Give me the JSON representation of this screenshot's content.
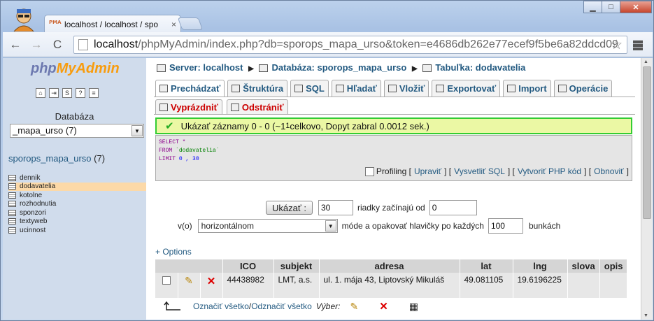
{
  "browser": {
    "tab_title": "localhost / localhost / spo",
    "tab_close": "×",
    "url_host": "localhost",
    "url_path": "/phpMyAdmin/index.php?db=sporops_mapa_urso&token=e4686db262e77ecef9f5be6a82ddcd09",
    "back": "←",
    "forward": "→",
    "reload": "C",
    "star": "☆",
    "minimize": "▁",
    "maximize": "□",
    "close": "✕"
  },
  "left": {
    "logo_php": "php",
    "logo_my": "My",
    "logo_admin": "Admin",
    "db_label": "Databáza",
    "db_select": "_mapa_urso (7)",
    "db_link": "sporops_mapa_urso",
    "db_count": "(7)",
    "tables": [
      {
        "name": "dennik",
        "selected": false
      },
      {
        "name": "dodavatelia",
        "selected": true
      },
      {
        "name": "kotolne",
        "selected": false
      },
      {
        "name": "rozhodnutia",
        "selected": false
      },
      {
        "name": "sponzori",
        "selected": false
      },
      {
        "name": "textyweb",
        "selected": false
      },
      {
        "name": "ucinnost",
        "selected": false
      }
    ]
  },
  "breadcrumb": {
    "server": "Server: localhost",
    "database": "Databáza: sporops_mapa_urso",
    "table": "Tabuľka: dodavatelia"
  },
  "tabs": [
    "Prechádzať",
    "Štruktúra",
    "SQL",
    "Hľadať",
    "Vložiť",
    "Exportovať",
    "Import",
    "Operácie"
  ],
  "tabs2": [
    "Vyprázdniť",
    "Odstrániť"
  ],
  "message": {
    "text_before": "Ukázať záznamy 0 - 0 (~1",
    "sup": "1",
    "text_after": " celkovo, Dopyt zabral 0.0012 sek.)"
  },
  "sql": {
    "line1": "SELECT *",
    "line2_kw": "FROM ",
    "line2_str": "`dodavatelia`",
    "line3_kw": "LIMIT ",
    "line3_num": "0 , 30"
  },
  "sql_options": {
    "profiling": "Profiling",
    "edit": "Upraviť",
    "explain": "Vysvetliť SQL",
    "php": "Vytvoriť PHP kód",
    "refresh": "Obnoviť"
  },
  "nav": {
    "show_button": "Ukázať :",
    "rows": "30",
    "rows_label": "riadky začínajú od",
    "start": "0",
    "mode_label": "v(o)",
    "mode": "horizontálnom",
    "repeat_label": "móde a opakovať hlavičky po každých",
    "repeat": "100",
    "cells_label": "bunkách"
  },
  "options_link": "+ Options",
  "table": {
    "headers": [
      "ICO",
      "subjekt",
      "adresa",
      "lat",
      "lng",
      "slova",
      "opis"
    ],
    "rows": [
      {
        "ico": "44438982",
        "subjekt": "LMT, a.s.",
        "adresa": "ul. 1. mája 43, Liptovský Mikuláš",
        "lat": "49.081105",
        "lng": "19.6196225",
        "slova": "",
        "opis": ""
      }
    ]
  },
  "bottom": {
    "check_all": "Označiť všetko",
    "slash": " / ",
    "uncheck_all": "Odznačiť všetko",
    "with_selected": "Výber:"
  }
}
